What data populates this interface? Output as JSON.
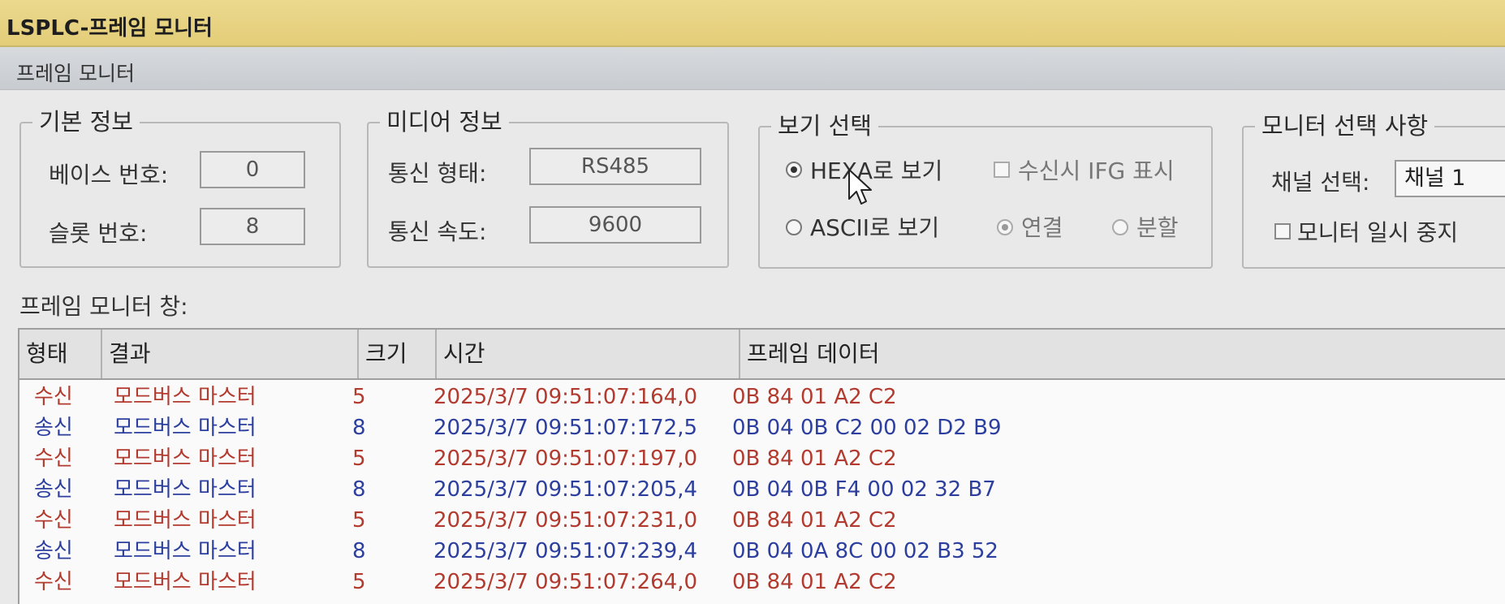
{
  "window": {
    "title": "LSPLC-프레임 모니터",
    "subtitle": "프레임 모니터"
  },
  "basic_info": {
    "legend": "기본 정보",
    "base_label": "베이스 번호:",
    "base_value": "0",
    "slot_label": "슬롯 번호:",
    "slot_value": "8"
  },
  "media_info": {
    "legend": "미디어 정보",
    "type_label": "통신 형태:",
    "type_value": "RS485",
    "speed_label": "통신 속도:",
    "speed_value": "9600"
  },
  "view_select": {
    "legend": "보기 선택",
    "hex_label": "HEXA로 보기",
    "ascii_label": "ASCII로 보기",
    "ifg_label": "수신시 IFG 표시",
    "connect_label": "연결",
    "split_label": "분할",
    "selected": "hex"
  },
  "monitor_options": {
    "legend": "모니터 선택 사항",
    "channel_label": "채널 선택:",
    "channel_value": "채널 1",
    "pause_label": "모니터 일시 중지"
  },
  "frame_window": {
    "label": "프레임 모니터 창:",
    "columns": [
      "형태",
      "결과",
      "크기",
      "시간",
      "프레임 데이터"
    ],
    "rows": [
      {
        "kind": "수신",
        "result": "모드버스 마스터",
        "size": "5",
        "time": "2025/3/7 09:51:07:164,0",
        "data": "0B 84 01 A2 C2",
        "dir": "rx"
      },
      {
        "kind": "송신",
        "result": "모드버스 마스터",
        "size": "8",
        "time": "2025/3/7 09:51:07:172,5",
        "data": "0B 04 0B C2 00 02 D2 B9",
        "dir": "tx"
      },
      {
        "kind": "수신",
        "result": "모드버스 마스터",
        "size": "5",
        "time": "2025/3/7 09:51:07:197,0",
        "data": "0B 84 01 A2 C2",
        "dir": "rx"
      },
      {
        "kind": "송신",
        "result": "모드버스 마스터",
        "size": "8",
        "time": "2025/3/7 09:51:07:205,4",
        "data": "0B 04 0B F4 00 02 32 B7",
        "dir": "tx"
      },
      {
        "kind": "수신",
        "result": "모드버스 마스터",
        "size": "5",
        "time": "2025/3/7 09:51:07:231,0",
        "data": "0B 84 01 A2 C2",
        "dir": "rx"
      },
      {
        "kind": "송신",
        "result": "모드버스 마스터",
        "size": "8",
        "time": "2025/3/7 09:51:07:239,4",
        "data": "0B 04 0A 8C 00 02 B3 52",
        "dir": "tx"
      },
      {
        "kind": "수신",
        "result": "모드버스 마스터",
        "size": "5",
        "time": "2025/3/7 09:51:07:264,0",
        "data": "0B 84 01 A2 C2",
        "dir": "rx"
      }
    ]
  },
  "colors": {
    "receive": "#b23a2e",
    "send": "#2c3f9e",
    "title_bar": "#e3cd78"
  }
}
